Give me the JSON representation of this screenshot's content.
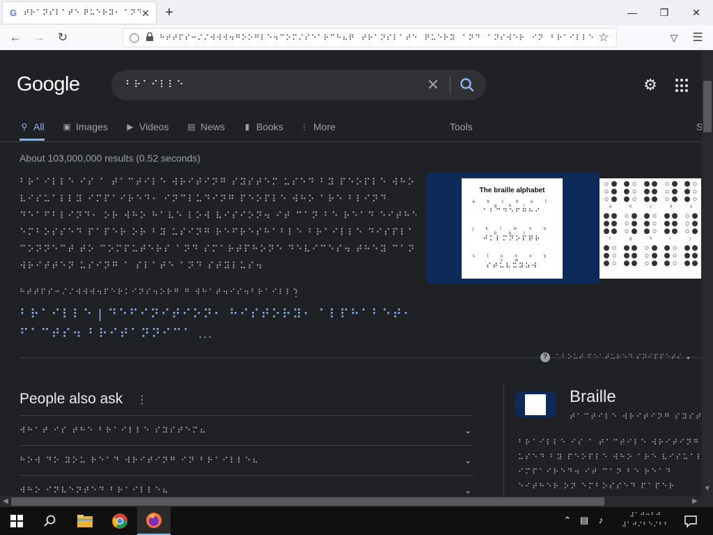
{
  "browser": {
    "tab_title": "⠞⠗⠁⠝⠎⠇⠁⠞⠑ ⠟⠥⠑⠗⠽⠂ ⠁⠝⠙ ⠁",
    "favicon": "G",
    "url": "⠓⠞⠞⠏⠎⠒⠌⠌⠺⠺⠺⠲⠛⠕⠕⠛⠇⠑⠲⠉⠕⠍⠌⠎⠑⠁⠗⠉⠓⠦⠟⠀⠞⠗⠁⠝⠎⠇⠁⠞⠑⠀⠟⠥⠑⠗⠽⠀⠁⠝⠙⠀⠁⠝⠎⠺⠑⠗⠀⠊⠝⠀⠃⠗⠁⠊⠇⠇⠑"
  },
  "google": {
    "logo": "Google",
    "query": "⠃⠗⠁⠊⠇⠇⠑",
    "tabs": [
      {
        "label": "All",
        "icon": "search-icon"
      },
      {
        "label": "Images",
        "icon": "image-icon"
      },
      {
        "label": "Videos",
        "icon": "play-icon"
      },
      {
        "label": "News",
        "icon": "news-icon"
      },
      {
        "label": "Books",
        "icon": "book-icon"
      },
      {
        "label": "More",
        "icon": "kebab-icon"
      }
    ],
    "tools_label": "Tools",
    "safesearch_label": "S",
    "result_stats": "About 103,000,000 results (0.52 seconds)",
    "snippet_lines": [
      "⠃⠗⠁⠊⠇⠇⠑ ⠊⠎ ⠁ ⠞⠁⠉⠞⠊⠇⠑ ⠺⠗⠊⠞⠊⠝⠛ ⠎⠽⠎⠞⠑⠍ ⠥⠎⠑⠙ ⠃⠽ ⠏⠑⠕⠏⠇⠑ ⠺⠓⠕ ⠁⠗⠑",
      "⠧⠊⠎⠥⠁⠇⠇⠽ ⠊⠍⠏⠁⠊⠗⠑⠙⠂ ⠊⠝⠉⠇⠥⠙⠊⠝⠛ ⠏⠑⠕⠏⠇⠑ ⠺⠓⠕ ⠁⠗⠑ ⠃⠇⠊⠝⠙",
      "⠙⠑⠁⠋⠃⠇⠊⠝⠙⠂ ⠕⠗ ⠺⠓⠕ ⠓⠁⠧⠑ ⠇⠕⠺ ⠧⠊⠎⠊⠕⠝⠲ ⠊⠞ ⠉⠁⠝ ⠃⠑ ⠗⠑⠁⠙ ⠑⠊⠞⠓⠑⠗ ⠕⠝",
      "⠑⠍⠃⠕⠎⠎⠑⠙ ⠏⠁⠏⠑⠗ ⠕⠗ ⠃⠽ ⠥⠎⠊⠝⠛ ⠗⠑⠋⠗⠑⠎⠓⠁⠃⠇⠑ ⠃⠗⠁⠊⠇⠇⠑ ⠙⠊⠎⠏⠇⠁⠽⠎ ⠞⠓⠁⠞",
      "⠉⠕⠝⠝⠑⠉⠞ ⠞⠕ ⠉⠕⠍⠏⠥⠞⠑⠗⠎ ⠁⠝⠙ ⠎⠍⠁⠗⠞⠏⠓⠕⠝⠑ ⠙⠑⠧⠊⠉⠑⠎⠲ ⠞⠓⠑⠽ ⠉⠁⠝ ⠃⠑",
      "⠺⠗⠊⠞⠞⠑⠝ ⠥⠎⠊⠝⠛ ⠁ ⠎⠇⠁⠞⠑ ⠁⠝⠙ ⠎⠞⠽⠇⠥⠎⠲"
    ],
    "result_cite": "⠓⠞⠞⠏⠎⠒⠌⠌⠺⠺⠺⠲⠏⠑⠗⠅⠊⠝⠎⠲⠕⠗⠛ ⠛ ⠺⠓⠁⠞⠲⠊⠎⠲⠃⠗⠁⠊⠇⠇⠑",
    "result_title_lines": [
      "⠃⠗⠁⠊⠇⠇⠑ | ⠙⠑⠋⠊⠝⠊⠞⠊⠕⠝⠂ ⠓⠊⠎⠞⠕⠗⠽⠂ ⠁⠇⠏⠓⠁⠃⠑⠞⠂ &",
      "⠋⠁⠉⠞⠎⠲ ⠃⠗⠊⠞⠁⠝⠝⠊⠉⠁ ..."
    ],
    "image_card_title": "The braille alphabet",
    "image_card_rows": [
      {
        "letters": "a b c d e f g h i",
        "dots": "⠁⠃⠉⠙⠑⠋⠛⠓⠊"
      },
      {
        "letters": "j k l m n o p q r",
        "dots": "⠚⠅⠇⠍⠝⠕⠏⠟⠗"
      },
      {
        "letters": "s t u v x y z w",
        "dots": "⠎⠞⠥⠧⠭⠽⠵⠺"
      }
    ],
    "dots_image_letters": "a b c d e f g h i j",
    "feedback_label": "⠁⠃⠕⠥⠞ ⠋⠑⠁⠞⠥⠗⠑⠙ ⠎⠝⠊⠏⠏⠑⠞⠎",
    "people_also_ask": {
      "title": "People also ask",
      "questions": [
        "⠺⠓⠁⠞ ⠊⠎ ⠞⠓⠑ ⠃⠗⠁⠊⠇⠇⠑ ⠎⠽⠎⠞⠑⠍⠦",
        "⠓⠕⠺ ⠙⠕ ⠽⠕⠥ ⠗⠑⠁⠙ ⠺⠗⠊⠞⠊⠝⠛ ⠊⠝ ⠃⠗⠁⠊⠇⠇⠑⠦",
        "⠺⠓⠕ ⠊⠝⠧⠑⠝⠞⠑⠙ ⠃⠗⠁⠊⠇⠇⠑⠦"
      ]
    },
    "knowledge_panel": {
      "title": "Braille",
      "subtitle": "⠞⠁⠉⠞⠊⠇⠑ ⠺⠗⠊⠞⠊⠝⠛ ⠎⠽⠎⠞⠑⠍",
      "desc_lines": [
        "⠃⠗⠁⠊⠇⠇⠑ ⠊⠎ ⠁ ⠞⠁⠉⠞⠊⠇⠑ ⠺⠗⠊⠞⠊⠝⠛ ⠎⠽⠎⠞⠑⠍",
        "⠥⠎⠑⠙ ⠃⠽ ⠏⠑⠕⠏⠇⠑ ⠺⠓⠕ ⠁⠗⠑ ⠧⠊⠎⠥⠁⠇⠇⠽",
        "⠊⠍⠏⠁⠊⠗⠑⠙⠲ ⠊⠞ ⠉⠁⠝ ⠃⠑ ⠗⠑⠁⠙",
        "⠑⠊⠞⠓⠑⠗ ⠕⠝ ⠑⠍⠃⠕⠎⠎⠑⠙ ⠏⠁⠏⠑⠗"
      ]
    }
  },
  "taskbar": {
    "clock_time": "⠼⠁⠚⠒⠃⠚",
    "clock_date": "⠼⠁⠚⠌⠃⠑⠌⠃⠃"
  },
  "colors": {
    "page_bg": "#202124",
    "link": "#8ab4f8",
    "text": "#bdc1c6",
    "heading": "#e8eaed",
    "image_panel_bg": "#0e2a58"
  }
}
